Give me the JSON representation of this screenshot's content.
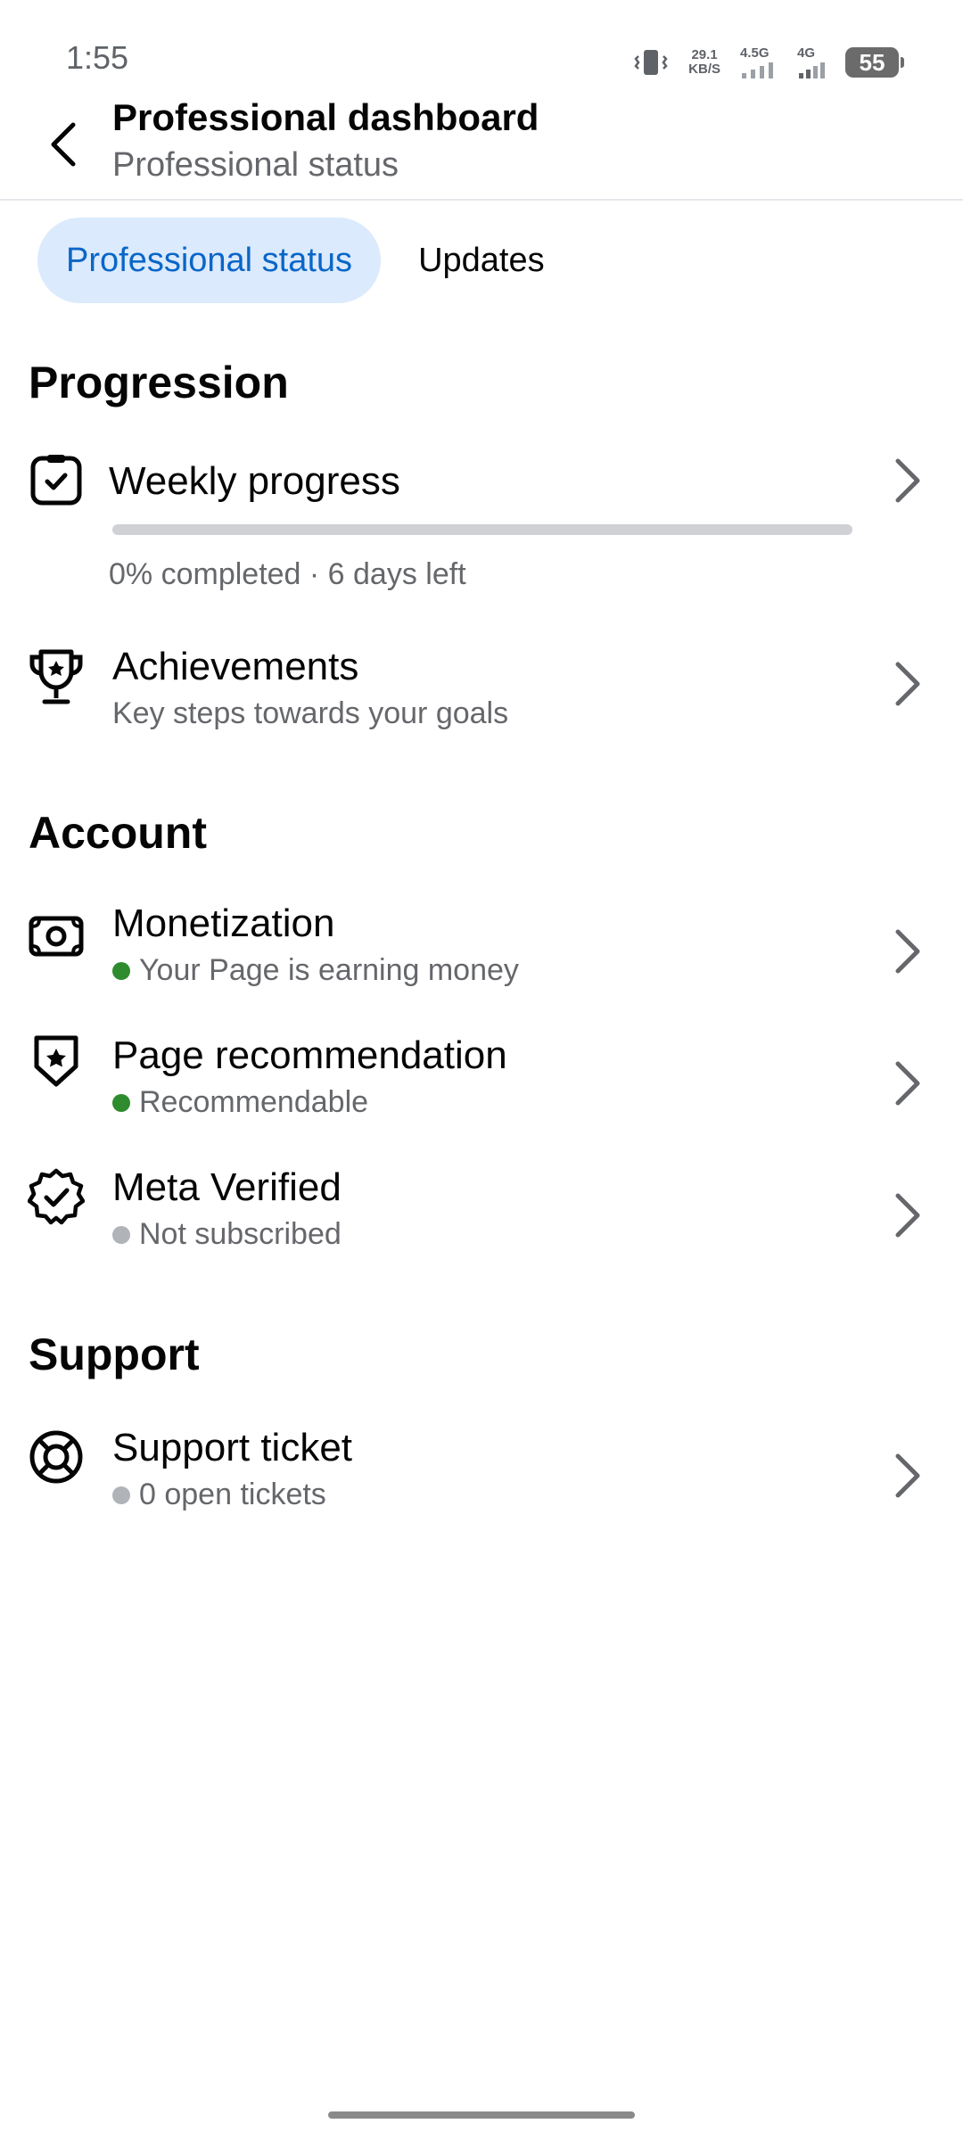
{
  "status_bar": {
    "time": "1:55",
    "speed_value": "29.1",
    "speed_unit": "KB/S",
    "net1": "4.5G",
    "net2": "4G",
    "battery": "55"
  },
  "header": {
    "title": "Professional dashboard",
    "subtitle": "Professional status"
  },
  "tabs": [
    {
      "label": "Professional status",
      "active": true
    },
    {
      "label": "Updates",
      "active": false
    }
  ],
  "sections": {
    "progression": {
      "title": "Progression",
      "weekly": {
        "label": "Weekly progress",
        "progress": 0,
        "status": "0% completed · 6 days left"
      },
      "achievements": {
        "label": "Achievements",
        "sub": "Key steps towards your goals"
      }
    },
    "account": {
      "title": "Account",
      "items": [
        {
          "label": "Monetization",
          "sub": "Your Page is earning money",
          "dot_color": "#2e8b2e"
        },
        {
          "label": "Page recommendation",
          "sub": "Recommendable",
          "dot_color": "#2e8b2e"
        },
        {
          "label": "Meta Verified",
          "sub": "Not subscribed",
          "dot_color": "#b0b3b8"
        }
      ]
    },
    "support": {
      "title": "Support",
      "items": [
        {
          "label": "Support ticket",
          "sub": "0 open tickets",
          "dot_color": "#b0b3b8"
        }
      ]
    }
  },
  "icons": {
    "back": "arrow-left-icon",
    "weekly": "checklist-icon",
    "achievements": "trophy-icon",
    "monetization": "money-icon",
    "recommendation": "shield-star-icon",
    "verified": "verified-badge-icon",
    "support": "lifebuoy-icon",
    "chevron": "chevron-right-icon"
  },
  "colors": {
    "accent": "#0a66c8",
    "tab_active_bg": "#dbeafc",
    "green": "#2e8b2e",
    "grey_dot": "#b0b3b8"
  }
}
